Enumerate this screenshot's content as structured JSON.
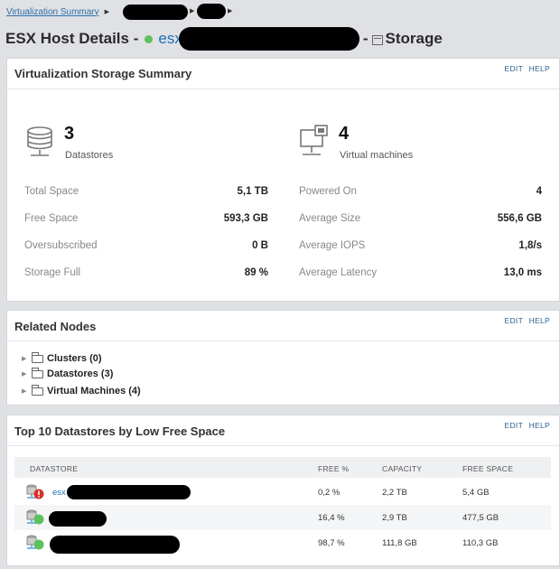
{
  "breadcrumb": {
    "root": "Virtualization Summary"
  },
  "title": {
    "prefix": "ESX Host Details -",
    "host": "esx",
    "dash": "-",
    "section": "Storage"
  },
  "summary": {
    "title": "Virtualization Storage Summary",
    "edit": "EDIT",
    "help": "HELP",
    "datastores_count": "3",
    "datastores_label": "Datastores",
    "vms_count": "4",
    "vms_label": "Virtual machines",
    "left": [
      {
        "label": "Total Space",
        "value": "5,1 TB"
      },
      {
        "label": "Free Space",
        "value": "593,3 GB"
      },
      {
        "label": "Oversubscribed",
        "value": "0 B"
      },
      {
        "label": "Storage Full",
        "value": "89 %"
      }
    ],
    "right": [
      {
        "label": "Powered On",
        "value": "4"
      },
      {
        "label": "Average Size",
        "value": "556,6 GB"
      },
      {
        "label": "Average IOPS",
        "value": "1,8/s"
      },
      {
        "label": "Average Latency",
        "value": "13,0 ms"
      }
    ]
  },
  "related": {
    "title": "Related Nodes",
    "edit": "EDIT",
    "help": "HELP",
    "items": [
      "Clusters (0)",
      "Datastores (3)",
      "Virtual Machines (4)"
    ]
  },
  "top10": {
    "title": "Top 10 Datastores by Low Free Space",
    "edit": "EDIT",
    "help": "HELP",
    "headers": [
      "DATASTORE",
      "FREE %",
      "CAPACITY",
      "FREE SPACE"
    ],
    "rows": [
      {
        "name": "esx",
        "free_pct": "0,2 %",
        "capacity": "2,2 TB",
        "free_space": "5,4 GB",
        "status": "critical"
      },
      {
        "name": "",
        "free_pct": "16,4 %",
        "capacity": "2,9 TB",
        "free_space": "477,5 GB",
        "status": "up"
      },
      {
        "name": "",
        "free_pct": "98,7 %",
        "capacity": "111,8 GB",
        "free_space": "110,3 GB",
        "status": "up"
      }
    ]
  },
  "colors": {
    "accent": "#1f6fb5",
    "up": "#5cc25c",
    "critical": "#d9302c"
  }
}
